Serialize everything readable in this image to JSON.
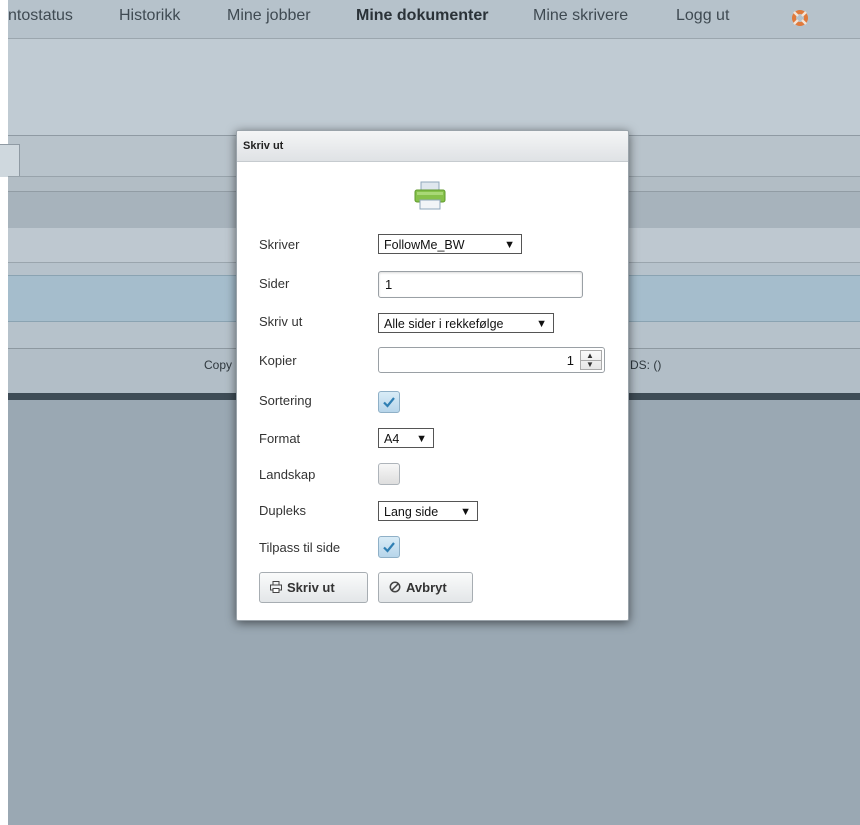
{
  "nav": {
    "items": [
      "ntostatus",
      "Historikk",
      "Mine jobber",
      "Mine dokumenter",
      "Mine skrivere",
      "Logg ut"
    ],
    "active": "Mine dokumenter"
  },
  "footer": {
    "left_fragment": "Copy",
    "right_fragment": "DS: ()"
  },
  "dialog": {
    "title": "Skriv ut",
    "fields": {
      "printer": {
        "label": "Skriver",
        "value": "FollowMe_BW"
      },
      "pages": {
        "label": "Sider",
        "value": "1"
      },
      "print_mode": {
        "label": "Skriv ut",
        "value": "Alle sider i rekkefølge"
      },
      "copies": {
        "label": "Kopier",
        "value": "1"
      },
      "collate": {
        "label": "Sortering",
        "checked": true
      },
      "format": {
        "label": "Format",
        "value": "A4"
      },
      "landscape": {
        "label": "Landskap",
        "checked": false
      },
      "duplex": {
        "label": "Dupleks",
        "value": "Lang side"
      },
      "fit_to_page": {
        "label": "Tilpass til side",
        "checked": true
      }
    },
    "buttons": {
      "print": "Skriv ut",
      "cancel": "Avbryt"
    }
  },
  "icons": {
    "printer": "printer-icon",
    "help": "lifebuoy-icon",
    "print_button": "print-icon",
    "cancel_button": "ban-icon"
  },
  "colors": {
    "backdrop": "#b6c2cb",
    "checkbox_checked": "#b7d5ea",
    "checkmark": "#2f7fb3",
    "printer_green": "#86c14a",
    "help_icon": "#e07a3c"
  }
}
